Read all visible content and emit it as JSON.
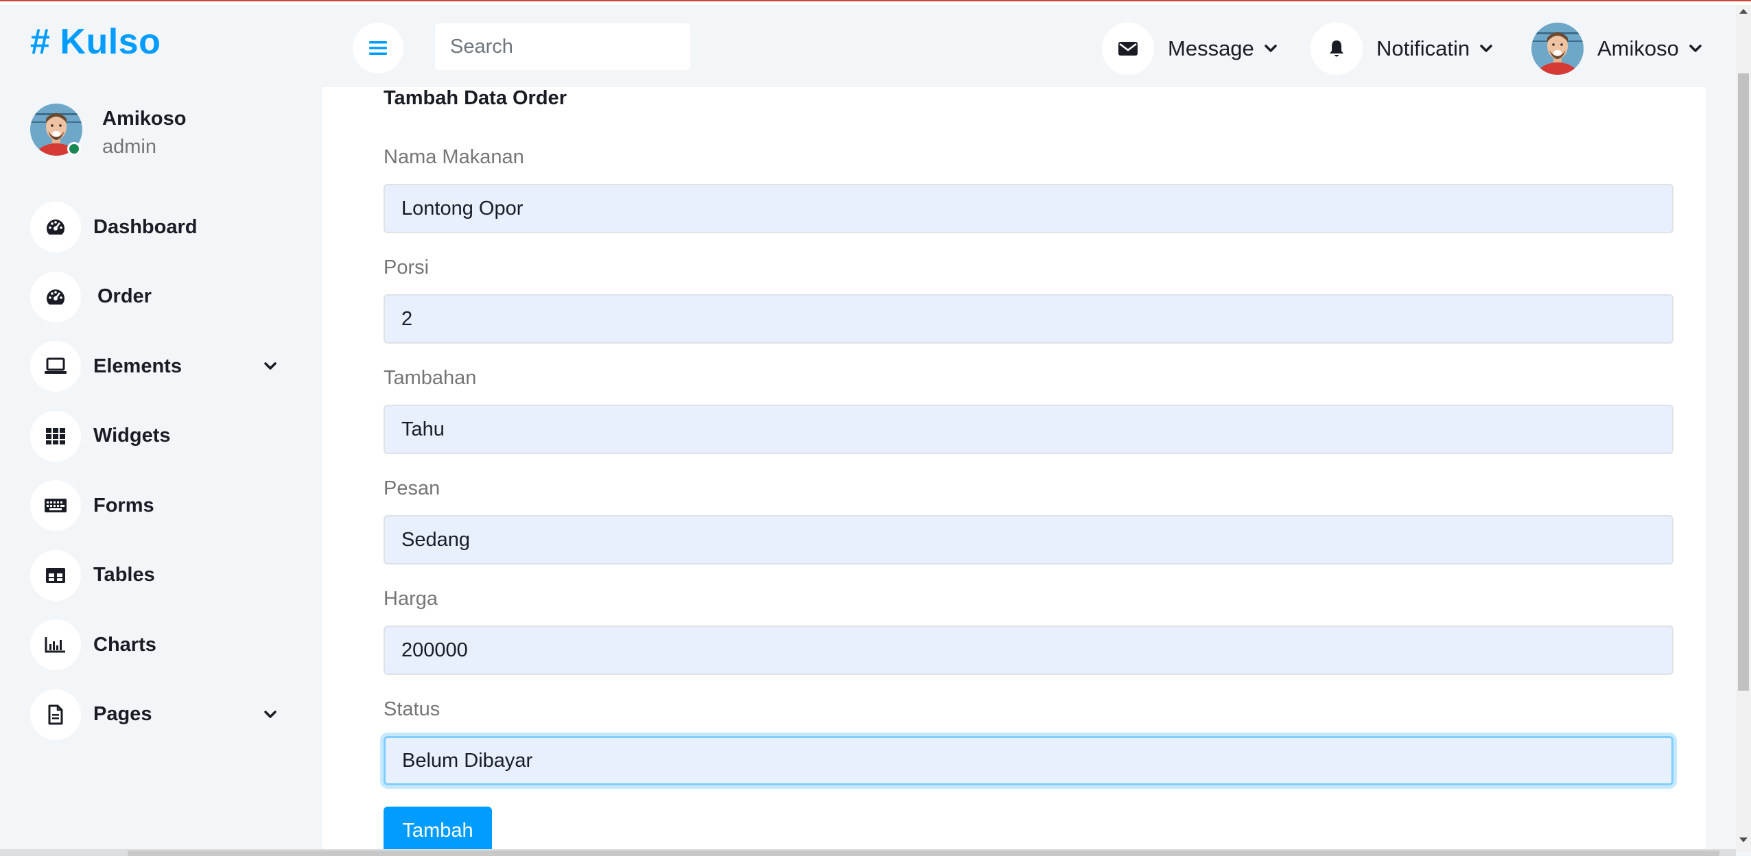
{
  "brand": {
    "symbol": "#",
    "name": "Kulso",
    "color": "#009cff"
  },
  "user": {
    "name": "Amikoso",
    "role": "admin",
    "status": "online"
  },
  "sidebar": {
    "items": [
      {
        "label": "Dashboard",
        "icon": "tachometer-icon",
        "expandable": false
      },
      {
        "label": "Order",
        "icon": "tachometer-icon",
        "expandable": false
      },
      {
        "label": "Elements",
        "icon": "laptop-icon",
        "expandable": true
      },
      {
        "label": "Widgets",
        "icon": "grid-icon",
        "expandable": false
      },
      {
        "label": "Forms",
        "icon": "keyboard-icon",
        "expandable": false
      },
      {
        "label": "Tables",
        "icon": "table-icon",
        "expandable": false
      },
      {
        "label": "Charts",
        "icon": "bar-chart-icon",
        "expandable": false
      },
      {
        "label": "Pages",
        "icon": "file-icon",
        "expandable": true
      }
    ]
  },
  "topbar": {
    "search_placeholder": "Search",
    "message_label": "Message",
    "notification_label": "Notificatin",
    "user_label": "Amikoso"
  },
  "form": {
    "title": "Tambah Data Order",
    "fields": [
      {
        "label": "Nama Makanan",
        "value": "Lontong Opor"
      },
      {
        "label": "Porsi",
        "value": "2"
      },
      {
        "label": "Tambahan",
        "value": "Tahu"
      },
      {
        "label": "Pesan",
        "value": "Sedang"
      },
      {
        "label": "Harga",
        "value": "200000"
      },
      {
        "label": "Status",
        "value": "Belum Dibayar",
        "focused": true
      }
    ],
    "submit_label": "Tambah"
  },
  "colors": {
    "primary": "#009cff",
    "input_bg": "#e8f0fe",
    "page_bg": "#f3f6f9",
    "online": "#198754"
  }
}
